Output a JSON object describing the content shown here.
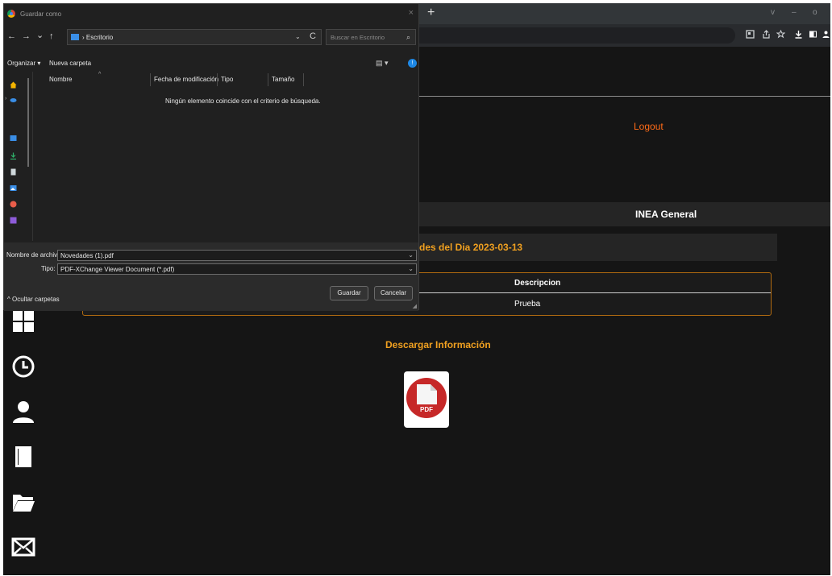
{
  "browser": {
    "new_tab": "+",
    "win_controls": [
      "v",
      "–",
      "o"
    ],
    "toolbar_icons": [
      "extension-icon",
      "share-icon",
      "star-icon",
      "download-icon",
      "sidebar-icon",
      "profile-icon"
    ]
  },
  "page": {
    "logout": "Logout",
    "inea_general": "INEA General",
    "novedades_title": "des del Dia 2023-03-13",
    "table": {
      "headers": [
        "Descripcion"
      ],
      "rows": [
        [
          "Prueba"
        ]
      ]
    },
    "download_label": "Descargar Información",
    "pdf_badge": "PDF",
    "side_nav_icons": [
      "dashboard-icon",
      "clock-icon",
      "user-icon",
      "book-icon",
      "folder-icon",
      "mail-icon"
    ],
    "colors": {
      "accent_orange": "#f0a020",
      "logout_orange": "#ff6b17",
      "background": "#151515"
    }
  },
  "dialog": {
    "title": "Guardar como",
    "close": "×",
    "nav": {
      "back": "←",
      "forward": "→",
      "recent": "⌄",
      "up": "↑"
    },
    "address": {
      "path": "› Escritorio",
      "dropdown": "⌄",
      "refresh": "C"
    },
    "search_placeholder": "Buscar en Escritorio",
    "commands": {
      "organize": "Organizar ▾",
      "new_folder": "Nueva carpeta",
      "view": "▤ ▾",
      "help": "!"
    },
    "columns": [
      "Nombre",
      "Fecha de modificación",
      "Tipo",
      "Tamaño"
    ],
    "sort_indicator": "^",
    "empty_message": "Ningún elemento coincide con el criterio de búsqueda.",
    "filename_label": "Nombre de archivo:",
    "filename_value": "Novedades (1).pdf",
    "type_label": "Tipo:",
    "type_value": "PDF-XChange Viewer Document (*.pdf)",
    "hide_folders": "^ Ocultar carpetas",
    "save_button": "Guardar",
    "cancel_button": "Cancelar"
  }
}
